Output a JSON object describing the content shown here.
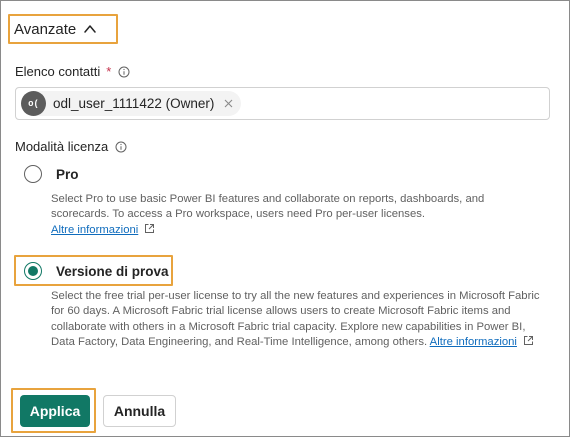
{
  "advanced": {
    "label": "Avanzate",
    "icon": "chevron-up-icon"
  },
  "contacts": {
    "label": "Elenco contatti",
    "required_mark": "*",
    "chip": {
      "initials": "o(",
      "text": "odl_user_1111422 (Owner)"
    }
  },
  "license": {
    "label": "Modalità licenza",
    "options": [
      {
        "label": "Pro",
        "selected": false,
        "description": "Select Pro to use basic Power BI features and collaborate on reports, dashboards, and scorecards. To access a Pro workspace, users need Pro per-user licenses.",
        "link": "Altre informazioni"
      },
      {
        "label": "Versione di prova",
        "selected": true,
        "description": "Select the free trial per-user license to try all the new features and experiences in Microsoft Fabric for 60 days. A Microsoft Fabric trial license allows users to create Microsoft Fabric items and collaborate with others in a Microsoft Fabric trial capacity. Explore new capabilities in Power BI, Data Factory, Data Engineering, and Real-Time Intelligence, among others.",
        "link": "Altre informazioni"
      }
    ]
  },
  "actions": {
    "apply": "Applica",
    "cancel": "Annulla"
  },
  "colors": {
    "accent": "#117865",
    "highlight": "#e8a33d",
    "link": "#0f6cbd"
  }
}
